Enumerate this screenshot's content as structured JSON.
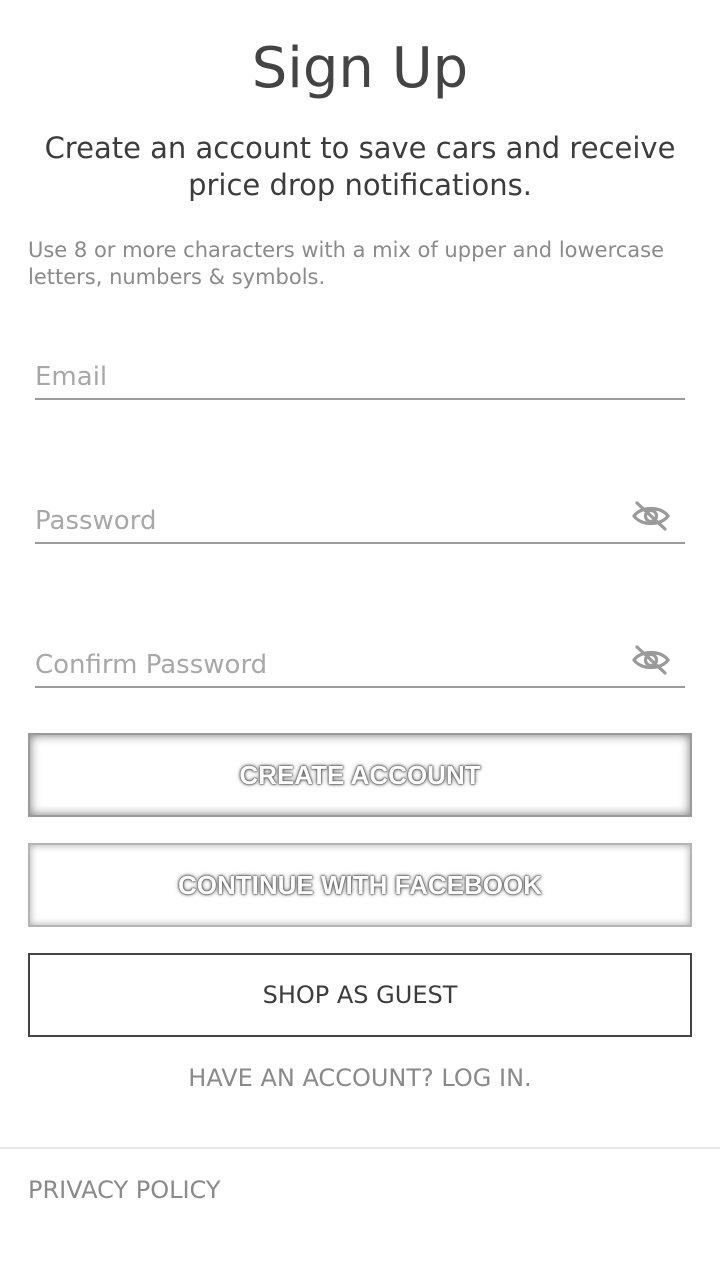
{
  "header": {
    "title": "Sign Up",
    "subtitle": "Create an account to save cars and receive price drop notifications."
  },
  "password_hint": "Use 8 or more characters with a mix of upper and lowercase letters, numbers & symbols.",
  "form": {
    "email": {
      "value": "",
      "placeholder": "Email"
    },
    "password": {
      "value": "",
      "placeholder": "Password",
      "toggle_icon": "eye-off-icon"
    },
    "confirm_password": {
      "value": "",
      "placeholder": "Confirm Password",
      "toggle_icon": "eye-off-icon"
    }
  },
  "buttons": {
    "create_account": "CREATE ACCOUNT",
    "continue_facebook": "CONTINUE WITH FACEBOOK",
    "shop_as_guest": "SHOP AS GUEST"
  },
  "login_link": "HAVE AN ACCOUNT? LOG IN.",
  "footer": {
    "privacy_policy": "PRIVACY POLICY"
  },
  "colors": {
    "text_primary": "#444444",
    "text_secondary": "#8a8a8a",
    "underline": "#9c9c9c",
    "background": "#ffffff"
  }
}
